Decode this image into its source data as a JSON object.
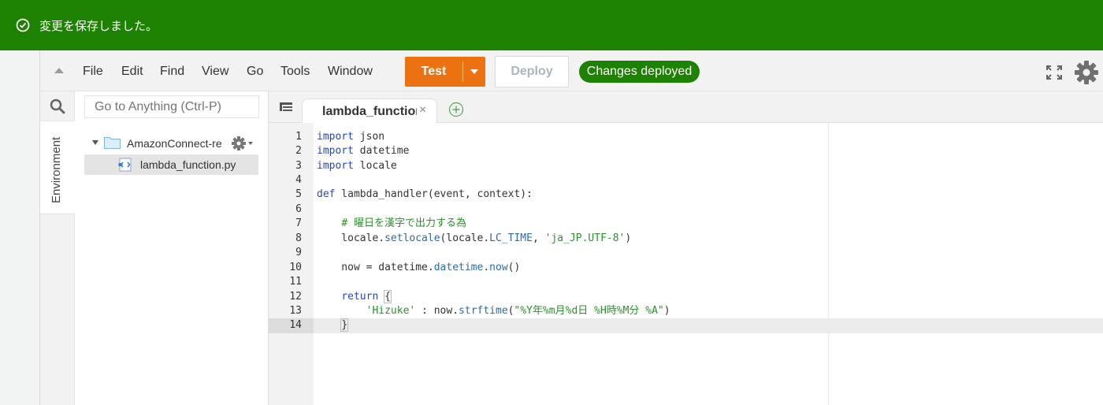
{
  "flash": {
    "message": "変更を保存しました。"
  },
  "menu": {
    "items": [
      "File",
      "Edit",
      "Find",
      "View",
      "Go",
      "Tools",
      "Window"
    ],
    "test_label": "Test",
    "deploy_label": "Deploy",
    "status_badge": "Changes deployed"
  },
  "sidebar": {
    "environment_label": "Environment",
    "goto_placeholder": "Go to Anything (Ctrl-P)",
    "root_folder": "AmazonConnect-res",
    "file": "lambda_function.py"
  },
  "tabs": {
    "active_title": "lambda_function",
    "close": "×"
  },
  "editor": {
    "lines": [
      {
        "n": "1",
        "code": "import json"
      },
      {
        "n": "2",
        "code": "import datetime"
      },
      {
        "n": "3",
        "code": "import locale"
      },
      {
        "n": "4",
        "code": ""
      },
      {
        "n": "5",
        "code": "def lambda_handler(event, context):"
      },
      {
        "n": "6",
        "code": ""
      },
      {
        "n": "7",
        "code": "    # 曜日を漢字で出力する為"
      },
      {
        "n": "8",
        "code": "    locale.setlocale(locale.LC_TIME, 'ja_JP.UTF-8')"
      },
      {
        "n": "9",
        "code": ""
      },
      {
        "n": "10",
        "code": "    now = datetime.datetime.now()"
      },
      {
        "n": "11",
        "code": ""
      },
      {
        "n": "12",
        "code": "    return {"
      },
      {
        "n": "13",
        "code": "        'Hizuke' : now.strftime(\"%Y年%m月%d日 %H時%M分 %A\")"
      },
      {
        "n": "14",
        "code": "    }"
      }
    ]
  },
  "colors": {
    "success_green": "#1d8102",
    "test_orange": "#ec7211"
  }
}
